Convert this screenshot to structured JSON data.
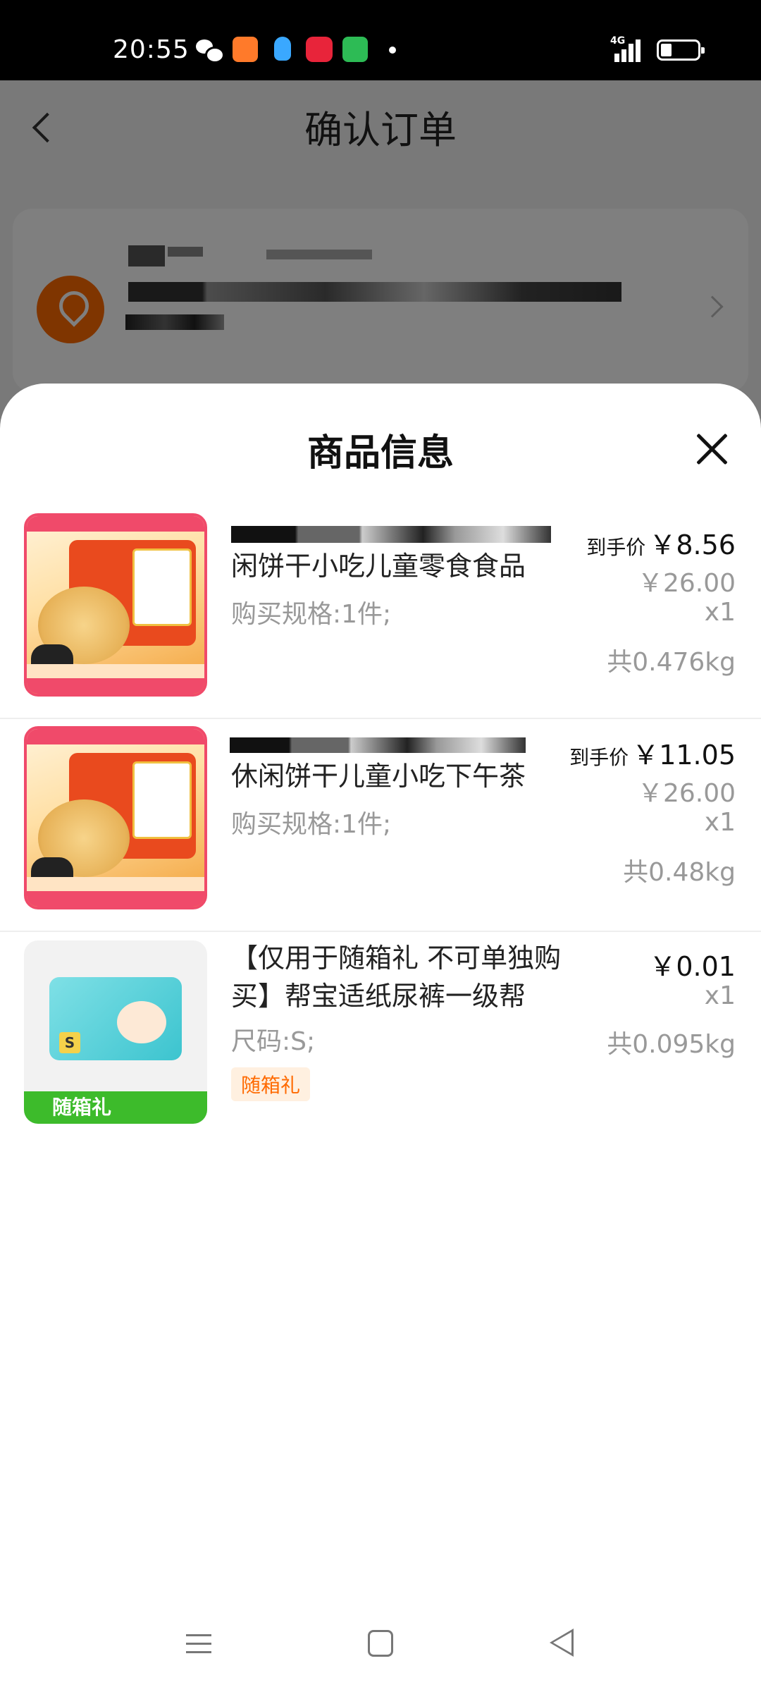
{
  "status_bar": {
    "time": "20:55",
    "network": "4G",
    "icons": [
      "wechat-icon",
      "app-icon",
      "qq-icon",
      "tmall-icon",
      "message-icon"
    ]
  },
  "background": {
    "title": "确认订单"
  },
  "sheet": {
    "title": "商品信息"
  },
  "items": [
    {
      "name": "闲饼干小吃儿童零食食品",
      "spec": "购买规格:1件;",
      "price_label": "到手价",
      "price": "￥8.56",
      "original_price": "￥26.00",
      "quantity": "x1",
      "weight": "共0.476kg"
    },
    {
      "name": "休闲饼干儿童小吃下午茶",
      "spec": "购买规格:1件;",
      "price_label": "到手价",
      "price": "￥11.05",
      "original_price": "￥26.00",
      "quantity": "x1",
      "weight": "共0.48kg"
    },
    {
      "name": "【仅用于随箱礼  不可单独购买】帮宝适纸尿裤一级帮",
      "spec": "尺码:S;",
      "price": "￥0.01",
      "quantity": "x1",
      "weight": "共0.095kg",
      "tag": "随箱礼",
      "thumb_band": "随箱礼"
    }
  ],
  "colors": {
    "accent": "#ff6a00",
    "gift_green": "#3dbb2b",
    "tag_bg": "#fff0e0"
  }
}
